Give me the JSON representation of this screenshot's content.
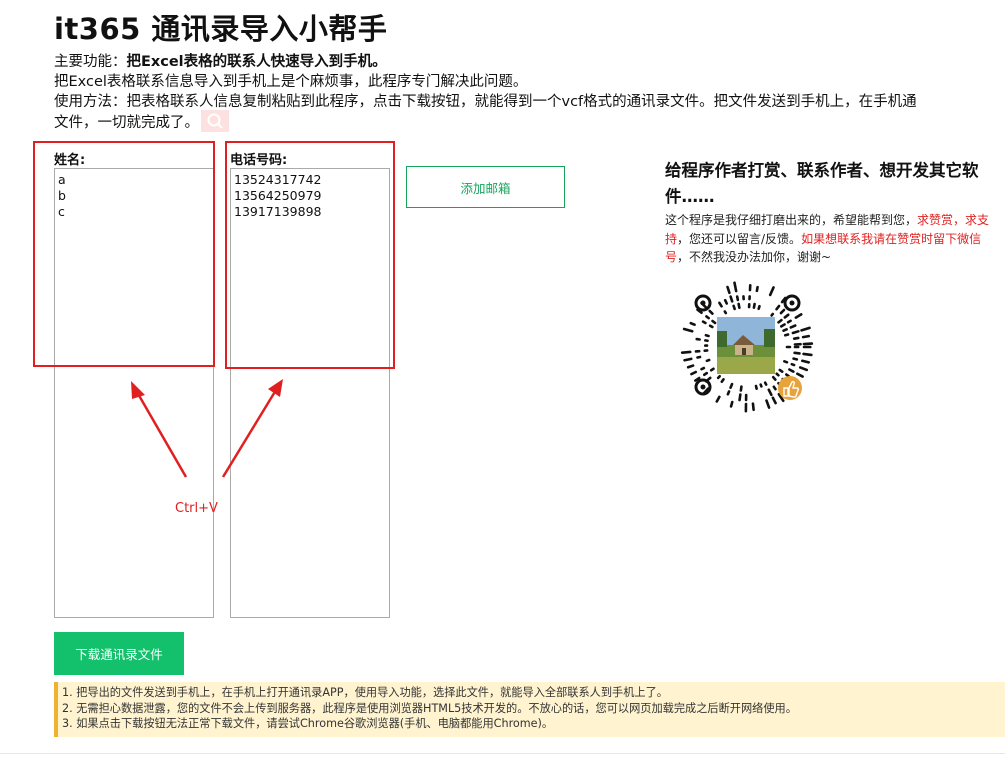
{
  "header": {
    "title": "it365 通讯录导入小帮手",
    "main_function_label": "主要功能：",
    "main_function_text": "把Excel表格的联系人快速导入到手机。",
    "intro": "把Excel表格联系信息导入到手机上是个麻烦事，此程序专门解决此问题。",
    "usage_line1": "使用方法：把表格联系人信息复制粘贴到此程序，点击下载按钮，就能得到一个vcf格式的通讯录文件。把文件发送到手机上，在手机通",
    "usage_line2": "文件，一切就完成了。"
  },
  "form": {
    "name_label": "姓名:",
    "phone_label": "电话号码:",
    "names": [
      "a",
      "b",
      "c"
    ],
    "phones": [
      "13524317742",
      "13564250979",
      "13917139898"
    ],
    "add_email_label": "添加邮箱",
    "download_label": "下载通讯录文件"
  },
  "annotation": {
    "ctrlv_label": "Ctrl+V"
  },
  "notes": [
    "1. 把导出的文件发送到手机上，在手机上打开通讯录APP，使用导入功能，选择此文件，就能导入全部联系人到手机上了。",
    "2. 无需担心数据泄露，您的文件不会上传到服务器，此程序是使用浏览器HTML5技术开发的。不放心的话，您可以网页加载完成之后断开网络使用。",
    "3. 如果点击下载按钮无法正常下载文件，请尝试Chrome谷歌浏览器(手机、电脑都能用Chrome)。"
  ],
  "donate": {
    "title": "给程序作者打赏、联系作者、想开发其它软件……",
    "text_part1": "这个程序是我仔细打磨出来的，希望能帮到您，",
    "text_red1": "求赞赏，求支持",
    "text_part2": "，您还可以留言/反馈。",
    "text_red2": "如果想联系我请在赞赏时留下微信号",
    "text_part3": "，不然我没办法加你，谢谢~"
  },
  "colors": {
    "accent_green": "#13c06b",
    "highlight_red": "#e02020",
    "notes_bg": "#fff3d0",
    "notes_border": "#f0b030"
  }
}
